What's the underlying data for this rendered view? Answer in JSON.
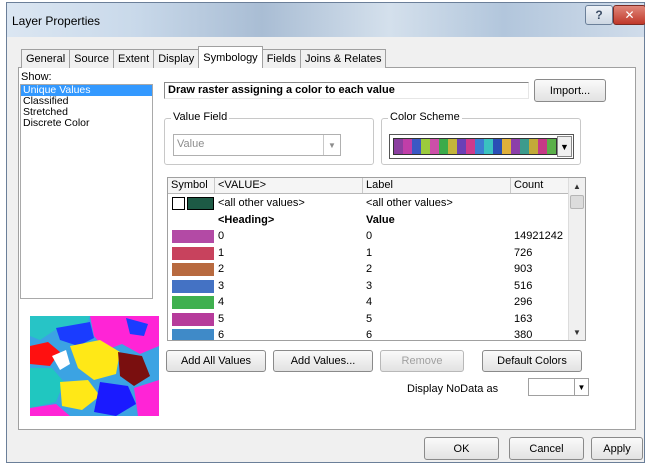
{
  "window": {
    "title": "Layer Properties"
  },
  "titlebar": {
    "help": "?",
    "close": "✕"
  },
  "tabs": [
    {
      "label": "General",
      "active": false
    },
    {
      "label": "Source",
      "active": false
    },
    {
      "label": "Extent",
      "active": false
    },
    {
      "label": "Display",
      "active": false
    },
    {
      "label": "Symbology",
      "active": true
    },
    {
      "label": "Fields",
      "active": false
    },
    {
      "label": "Joins & Relates",
      "active": false
    }
  ],
  "show": {
    "label": "Show:",
    "items": [
      {
        "label": "Unique Values",
        "selected": true
      },
      {
        "label": "Classified",
        "selected": false
      },
      {
        "label": "Stretched",
        "selected": false
      },
      {
        "label": "Discrete Color",
        "selected": false
      }
    ]
  },
  "description": "Draw raster assigning a color to each value",
  "import_button": "Import...",
  "value_field": {
    "legend": "Value Field",
    "value": "Value"
  },
  "color_scheme": {
    "legend": "Color Scheme",
    "colors": [
      "#8b3fa0",
      "#c03ea8",
      "#3b58c4",
      "#9ccb3d",
      "#cc4fa8",
      "#3bab4a",
      "#c3b43b",
      "#6a40b6",
      "#cf3a8c",
      "#3c7ed2",
      "#3ac2c0",
      "#2a4fb5",
      "#e0b03a",
      "#8c3fa9",
      "#3c9b8c",
      "#c3aa38",
      "#c63986",
      "#5bb04a"
    ]
  },
  "table": {
    "headers": {
      "symbol": "Symbol",
      "value": "<VALUE>",
      "label": "Label",
      "count": "Count"
    },
    "other_row": {
      "value": "<all other values>",
      "label": "<all other values>",
      "symbol_color": "#1d5a45"
    },
    "heading_row": {
      "value": "<Heading>",
      "label": "Value"
    },
    "rows": [
      {
        "value": "0",
        "label": "0",
        "count": "14921242",
        "color": "#b34aa5"
      },
      {
        "value": "1",
        "label": "1",
        "count": "726",
        "color": "#c8425d"
      },
      {
        "value": "2",
        "label": "2",
        "count": "903",
        "color": "#b86a3f"
      },
      {
        "value": "3",
        "label": "3",
        "count": "516",
        "color": "#4472c4"
      },
      {
        "value": "4",
        "label": "4",
        "count": "296",
        "color": "#3fb04f"
      },
      {
        "value": "5",
        "label": "5",
        "count": "163",
        "color": "#b63b9b"
      },
      {
        "value": "6",
        "label": "6",
        "count": "380",
        "color": "#3f8ac8"
      }
    ]
  },
  "buttons": {
    "add_all": "Add All Values",
    "add_values": "Add Values...",
    "remove": "Remove",
    "default_colors": "Default Colors",
    "ok": "OK",
    "cancel": "Cancel",
    "apply": "Apply"
  },
  "nodata": {
    "label": "Display NoData as"
  }
}
